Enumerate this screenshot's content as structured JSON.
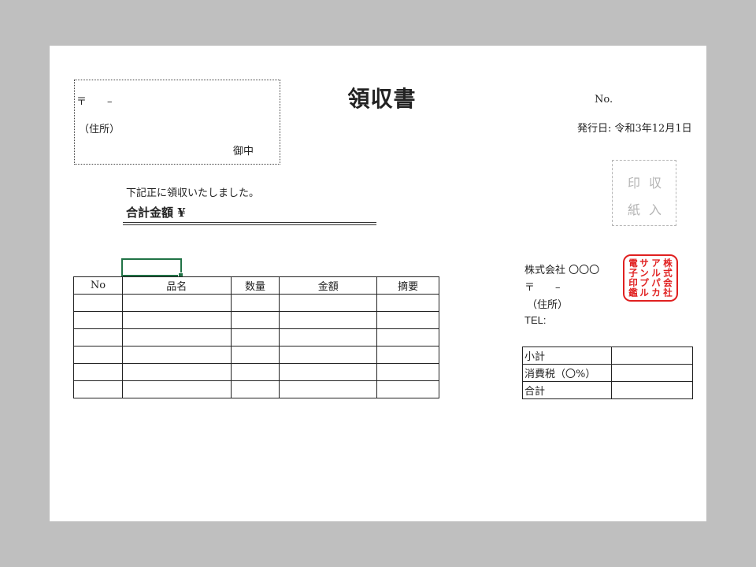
{
  "receipt": {
    "title": "領収書",
    "number_label": "No.",
    "issue_date": "発行日: 令和3年12月1日"
  },
  "recipient": {
    "postal": "〒　　–",
    "address": "（住所）",
    "honorific": "御中"
  },
  "statement": {
    "text": "下記正に領収いたしました。",
    "total_label": "合計金額  ¥"
  },
  "revenue_stamp": {
    "chars": [
      "印",
      "収",
      "紙",
      "入"
    ]
  },
  "items_table": {
    "headers": [
      "No",
      "品名",
      "数量",
      "金額",
      "摘要"
    ],
    "row_count": 6
  },
  "issuer": {
    "company": "株式会社 〇〇〇",
    "postal": "〒　　–",
    "address": "（住所）",
    "tel": "TEL:"
  },
  "seal": {
    "columns": [
      "株式会社",
      "アルパカ",
      "サンプル",
      "電子印鑑"
    ],
    "color": "#e02020"
  },
  "summary_table": {
    "rows": [
      "小計",
      "消費税（〇%）",
      "合計"
    ]
  },
  "colors": {
    "background": "#bfbfbf",
    "sheet": "#ffffff",
    "selection": "#217346"
  }
}
